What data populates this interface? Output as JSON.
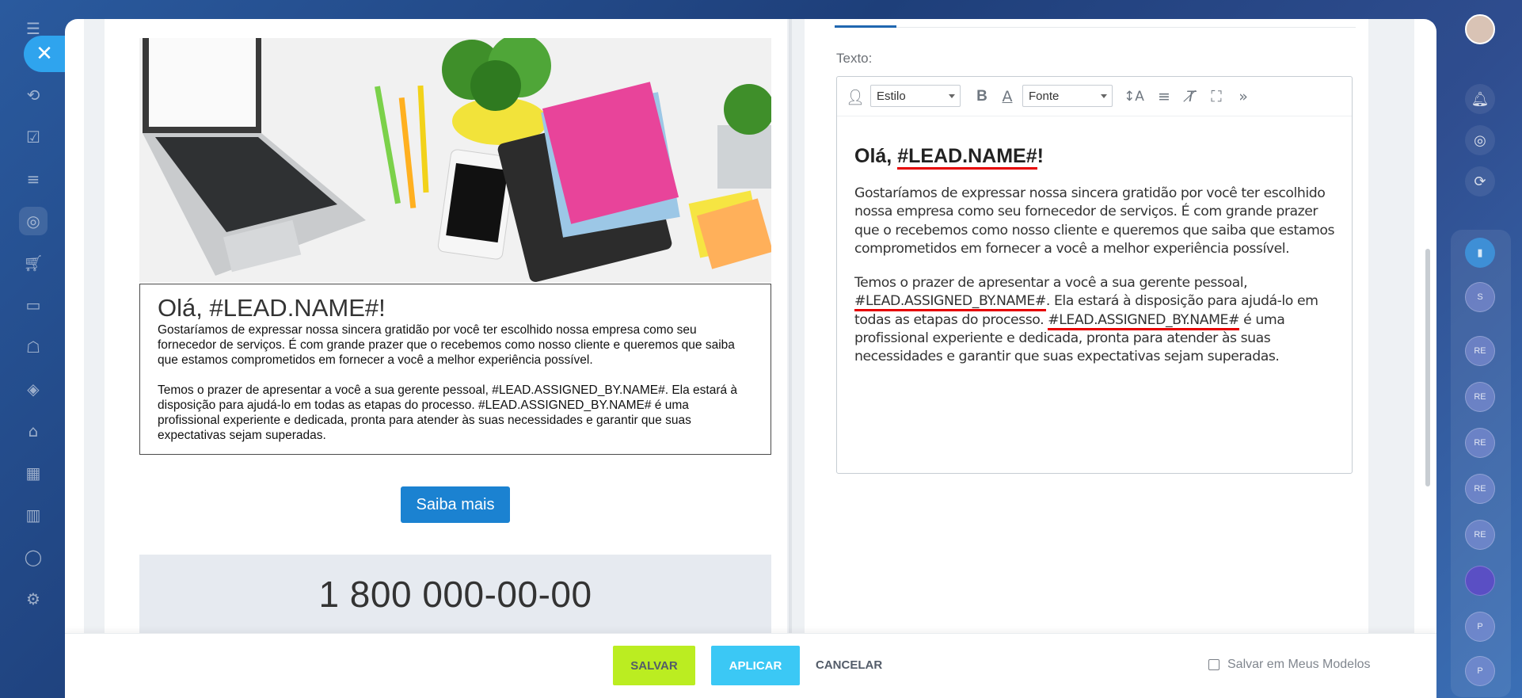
{
  "sidebar_left": {
    "close_icon": "close-icon",
    "icons": [
      "menu-icon",
      "connections-icon",
      "tasks-icon",
      "filter-icon",
      "target-icon",
      "cart-icon",
      "card-icon",
      "robot-icon",
      "box-icon",
      "warehouse-icon",
      "calendar-icon",
      "chart-icon",
      "circle-icon",
      "gear-icon"
    ]
  },
  "sidebar_right": {
    "avatar_icon": "avatar-icon",
    "icons": [
      "bell-icon",
      "target-icon",
      "sync-icon"
    ],
    "bookmark_icon": "bookmark-icon",
    "contacts": [
      "S",
      "RE",
      "RE",
      "RE",
      "RE",
      "RE",
      "",
      "P",
      "P"
    ]
  },
  "preview": {
    "heading": "Olá, #LEAD.NAME#!",
    "paragraph1": "Gostaríamos de expressar nossa sincera gratidão por você ter escolhido nossa empresa como seu fornecedor de serviços. É com grande prazer que o recebemos como nosso cliente e queremos que saiba que estamos comprometidos em fornecer a você a melhor experiência possível.",
    "paragraph2": "Temos o prazer de apresentar a você a sua gerente pessoal, #LEAD.ASSIGNED_BY.NAME#. Ela estará à disposição para ajudá-lo em todas as etapas do processo. #LEAD.ASSIGNED_BY.NAME# é uma profissional experiente e dedicada, pronta para atender às suas necessidades e garantir que suas expectativas sejam superadas.",
    "button_label": "Saiba mais",
    "phone": "1 800 000-00-00"
  },
  "editor": {
    "texto_label": "Texto:",
    "style_select": "Estilo",
    "font_select": "Fonte",
    "heading_prefix": "Olá, ",
    "heading_token": "#LEAD.NAME#",
    "heading_suffix": "!",
    "paragraph1": "Gostaríamos de expressar nossa sincera gratidão por você ter escolhido nossa empresa como seu fornecedor de serviços. É com grande prazer que o recebemos como nosso cliente e queremos que saiba que estamos comprometidos em fornecer a você a melhor experiência possível.",
    "p2_part1": "Temos o prazer de apresentar a você a sua gerente pessoal, ",
    "p2_token1": "#LEAD.ASSIGNED_BY.NAME#",
    "p2_part2": ". Ela estará à disposição para ajudá-lo em todas as etapas do processo. ",
    "p2_token2": "#LEAD.ASSIGNED_BY.NAME#",
    "p2_part3": " é uma profissional experiente e dedicada, pronta para atender às suas necessidades e garantir que suas expectativas sejam superadas."
  },
  "footer": {
    "save_label": "SALVAR",
    "apply_label": "APLICAR",
    "cancel_label": "CANCELAR",
    "save_templates_label": "Salvar em Meus Modelos"
  },
  "colors": {
    "save_button": "#bbed21",
    "apply_button": "#3bc8f5",
    "cta_button": "#1b82d1",
    "token_underline": "#e60000"
  }
}
